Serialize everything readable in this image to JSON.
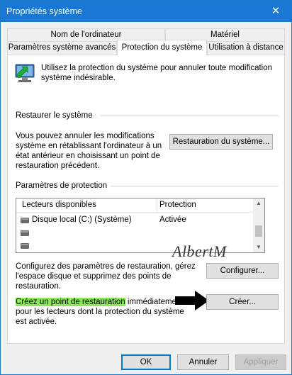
{
  "window": {
    "title": "Propriétés système",
    "close_glyph": "✕"
  },
  "tabs": [
    {
      "label": "Nom de l'ordinateur",
      "selected": false
    },
    {
      "label": "Matériel",
      "selected": false
    },
    {
      "label": "Paramètres système avancés",
      "selected": false
    },
    {
      "label": "Protection du système",
      "selected": true
    },
    {
      "label": "Utilisation à distance",
      "selected": false
    }
  ],
  "intro": {
    "icon": "system-protection-icon",
    "line1": "Utilisez la protection du système pour annuler toute modification",
    "line2": "système indésirable."
  },
  "restore": {
    "heading": "Restaurer le système",
    "line1": "Vous pouvez annuler les modifications",
    "line2": "système en rétablissant l'ordinateur à un",
    "line3": "état antérieur en choisissant un point de",
    "line4": "restauration précédent.",
    "button": "Restauration du système..."
  },
  "protection": {
    "heading": "Paramètres de protection",
    "columns": [
      "Lecteurs disponibles",
      "Protection"
    ],
    "rows": [
      {
        "drive": "Disque local (C:) (Système)",
        "status": "Activée"
      },
      {
        "drive": "",
        "status": ""
      },
      {
        "drive": "",
        "status": ""
      }
    ],
    "scroll_up_glyph": "▲",
    "scroll_down_glyph": "▼"
  },
  "configure": {
    "line1": "Configurez des paramètres de restauration, gérez",
    "line2": "l'espace disque et supprimez des points de",
    "line3": "restauration.",
    "button": "Configurer..."
  },
  "create": {
    "highlight": "Créez un point de restauration",
    "line1_rest": " immédiatement",
    "line2": "pour les lecteurs dont la protection du système",
    "line3": "est activée.",
    "button": "Créer...",
    "highlight_color": "#8ce65a"
  },
  "watermark": "AlbertM",
  "footer": {
    "ok": "OK",
    "cancel": "Annuler",
    "apply": "Appliquer"
  },
  "colors": {
    "titlebar": "#1a78d4",
    "accent": "#0078d7"
  }
}
